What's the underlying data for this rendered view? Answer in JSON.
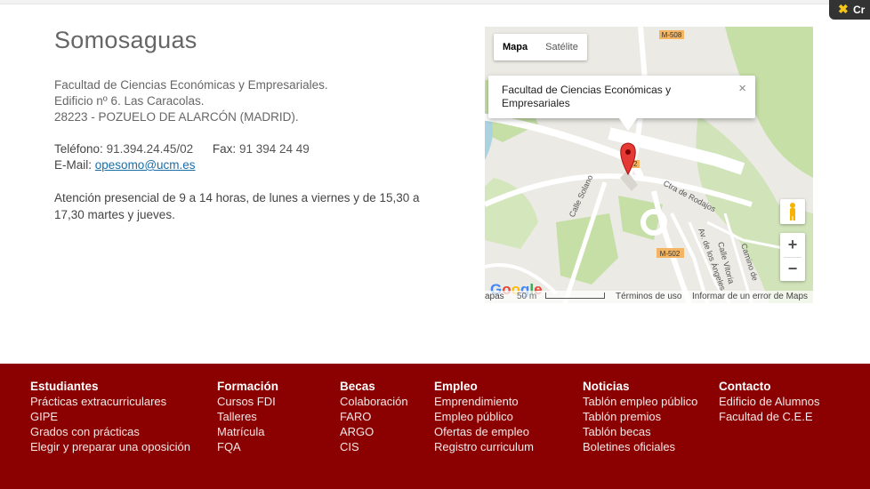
{
  "corner": {
    "text": "Cr"
  },
  "office": {
    "title": "Somosaguas",
    "address": [
      "Facultad de Ciencias Económicas y Empresariales.",
      "Edificio nº 6. Las Caracolas.",
      "28223 - POZUELO DE ALARCÓN (MADRID)."
    ],
    "phone_label": "Teléfono:",
    "phone": "91.394.24.45/02",
    "fax_label": "Fax:",
    "fax": "91 394 24 49",
    "email_label": "E-Mail:",
    "email": "opesomo@ucm.es",
    "hours": "Atención presencial de 9 a 14 horas, de lunes a viernes y de 15,30 a 17,30 martes y jueves."
  },
  "map": {
    "type_map": "Mapa",
    "type_satellite": "Satélite",
    "infowindow": "Facultad de Ciencias Económicas y Empresariales",
    "close": "×",
    "zoom_in": "+",
    "zoom_out": "−",
    "labels": {
      "m508": "M-508",
      "m502a": "M-502",
      "m502b": "02",
      "rodajos": "Ctra de Rodajos",
      "solano": "Calle Solano",
      "angeles": "Av. de los Ángeles",
      "vitoria": "Calle Vitoria",
      "camino": "Camino de"
    },
    "footer": {
      "datos": "apas",
      "escala": "50 m",
      "terms": "Términos de uso",
      "report": "Informar de un error de Maps"
    },
    "colors": {
      "land": "#ebeae4",
      "green": "#c5dfa6",
      "road": "#ffffff",
      "water": "#aad3df",
      "marker": "#e53935"
    }
  },
  "footer": {
    "background": "#8b0000",
    "columns": [
      {
        "heading": "Estudiantes",
        "items": [
          "Prácticas extracurriculares",
          "GIPE",
          "Grados con prácticas",
          "Elegir y preparar una oposición"
        ]
      },
      {
        "heading": "Formación",
        "items": [
          "Cursos FDI",
          "Talleres",
          "Matrícula",
          "FQA"
        ]
      },
      {
        "heading": "Becas",
        "items": [
          "Colaboración",
          "FARO",
          "ARGO",
          "CIS"
        ]
      },
      {
        "heading": "Empleo",
        "items": [
          "Emprendimiento",
          "Empleo público",
          "Ofertas de empleo",
          "Registro curriculum"
        ]
      },
      {
        "heading": "Noticias",
        "items": [
          "Tablón empleo público",
          "Tablón premios",
          "Tablón becas",
          "Boletines oficiales"
        ]
      },
      {
        "heading": "Contacto",
        "items": [
          "Edificio de Alumnos",
          "Facultad de C.E.E"
        ]
      }
    ]
  }
}
